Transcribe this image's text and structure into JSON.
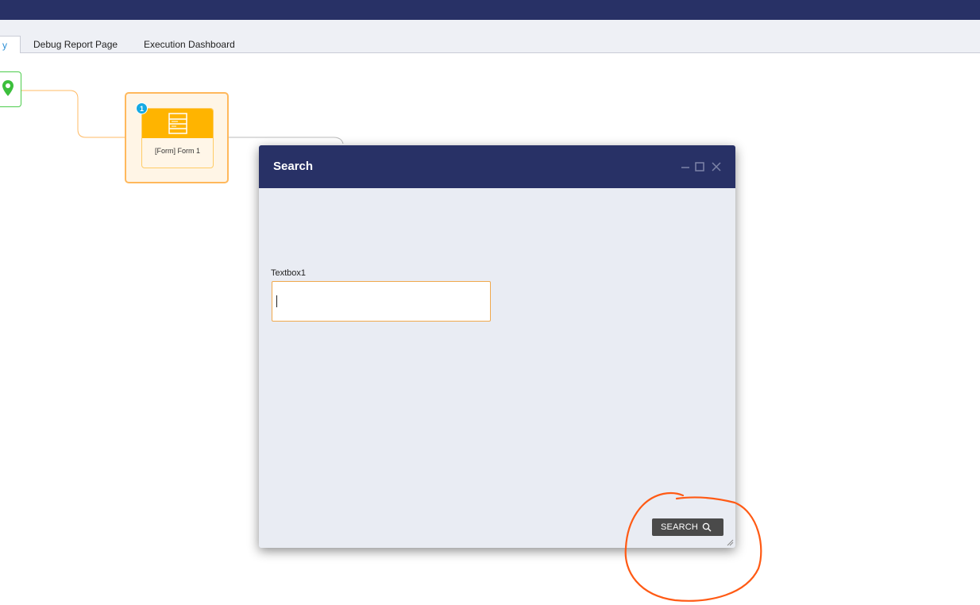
{
  "tabs": [
    {
      "label": "y",
      "active": true
    },
    {
      "label": "Debug Report Page",
      "active": false
    },
    {
      "label": "Execution Dashboard",
      "active": false
    }
  ],
  "flow": {
    "start_icon": "location-pin-icon",
    "step": {
      "label": "[Form] Form 1",
      "badge": "1",
      "icon": "form-icon"
    }
  },
  "modal": {
    "title": "Search",
    "controls": [
      "minimize-icon",
      "maximize-icon",
      "close-icon"
    ],
    "textbox": {
      "label": "Textbox1",
      "value": ""
    },
    "button": {
      "label": "SEARCH",
      "icon": "search-icon"
    }
  },
  "colors": {
    "header": "#283166",
    "accent": "#ffb400",
    "annotation": "#ff5a14"
  }
}
